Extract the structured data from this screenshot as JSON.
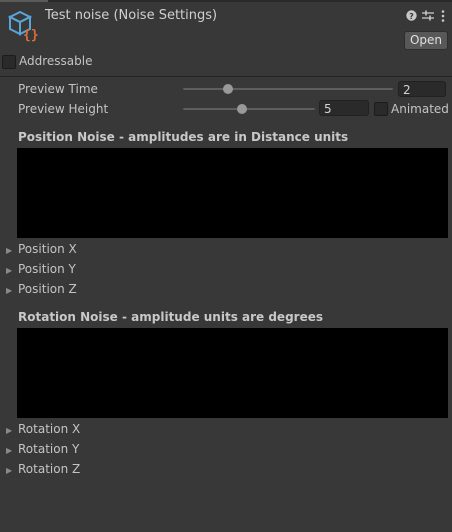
{
  "header": {
    "title": "Test noise (Noise Settings)",
    "open_label": "Open",
    "icons": [
      "script-cube-icon",
      "help-icon",
      "settings-sliders-icon",
      "more-vert-icon"
    ]
  },
  "addressable": {
    "label": "Addressable",
    "checked": false
  },
  "preview_time": {
    "label": "Preview Time",
    "value": "2",
    "slider_level": 0.2
  },
  "preview_height": {
    "label": "Preview Height",
    "value": "5",
    "slider_level": 0.4,
    "animated_label": "Animated",
    "animated_checked": false
  },
  "position_noise": {
    "title": "Position Noise - amplitudes are in Distance units",
    "items": [
      "Position X",
      "Position Y",
      "Position Z"
    ]
  },
  "rotation_noise": {
    "title": "Rotation Noise - amplitude units are degrees",
    "items": [
      "Rotation X",
      "Rotation Y",
      "Rotation Z"
    ]
  },
  "colors": {
    "background": "#383838",
    "graph": "#000000",
    "icon_blue": "#5aa5d8",
    "icon_orange": "#e06c3a"
  }
}
